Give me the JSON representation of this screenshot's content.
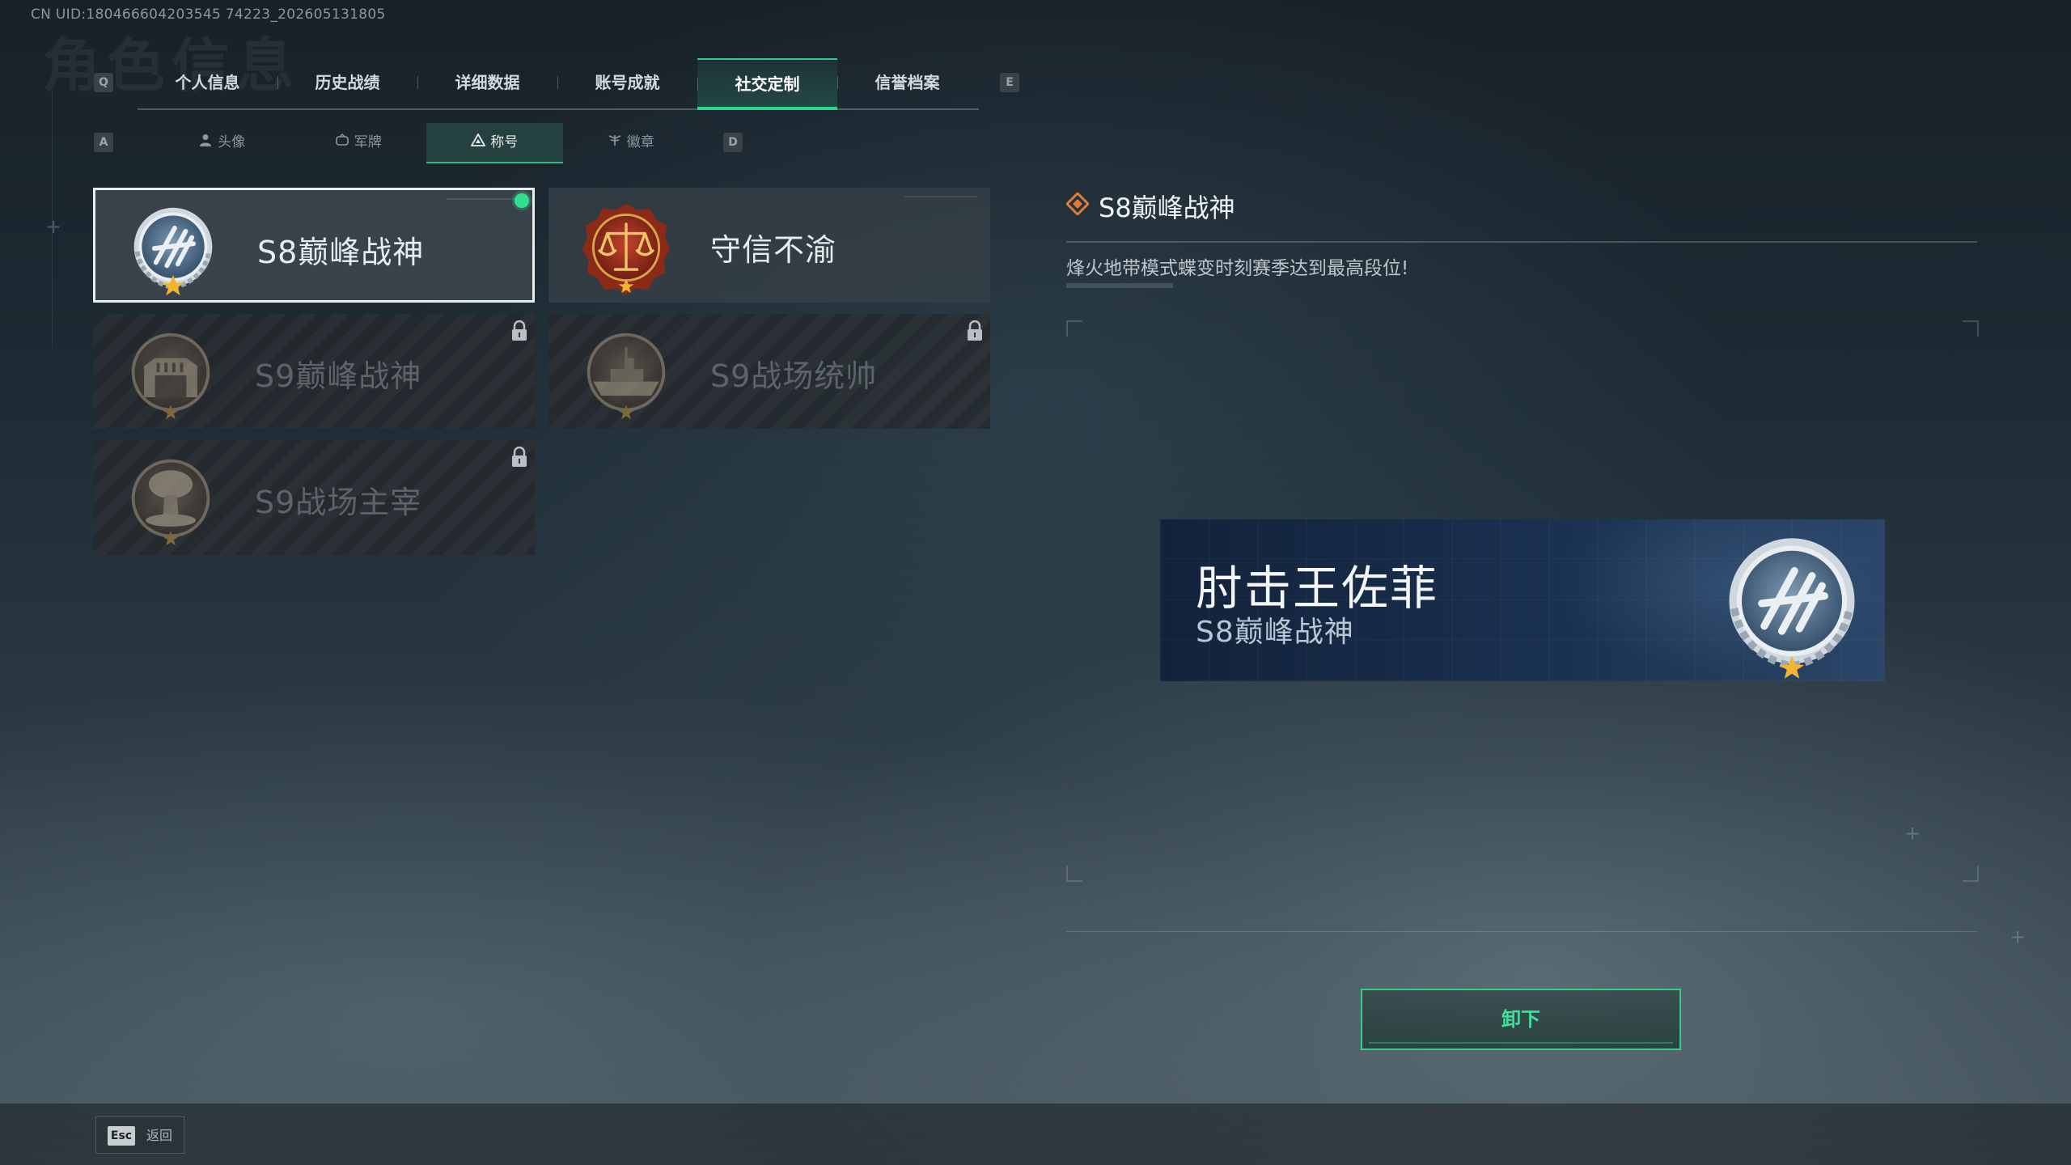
{
  "uid": "CN UID:180466604203545 74223_202605131805",
  "header": {
    "ghost_title": "角色信息",
    "prev_key": "Q",
    "next_key": "E",
    "tabs": [
      "个人信息",
      "历史战绩",
      "详细数据",
      "账号成就",
      "社交定制",
      "信誉档案"
    ],
    "active_tab": "社交定制"
  },
  "subnav": {
    "prev_key": "A",
    "next_key": "D",
    "tabs": [
      {
        "label": "头像",
        "icon": "person-icon"
      },
      {
        "label": "军牌",
        "icon": "dogtag-icon"
      },
      {
        "label": "称号",
        "icon": "title-triangle-icon"
      },
      {
        "label": "徽章",
        "icon": "wings-badge-icon"
      }
    ],
    "active_tab": "称号"
  },
  "titles": [
    {
      "name": "S8巅峰战神",
      "badge": "laurel-blue-badge",
      "state": "equipped"
    },
    {
      "name": "守信不渝",
      "badge": "scales-of-justice-badge",
      "state": "unlocked"
    },
    {
      "name": "S9巅峰战神",
      "badge": "fortress-badge",
      "state": "locked"
    },
    {
      "name": "S9战场统帅",
      "badge": "warship-badge",
      "state": "locked"
    },
    {
      "name": "S9战场主宰",
      "badge": "mushroom-cloud-badge",
      "state": "locked"
    }
  ],
  "detail": {
    "title": "S8巅峰战神",
    "description": "烽火地带模式蝶变时刻赛季达到最高段位!"
  },
  "preview": {
    "player_name": "肘击王佐菲",
    "title": "S8巅峰战神"
  },
  "actions": {
    "unequip_label": "卸下",
    "esc_key": "Esc",
    "back_label": "返回"
  },
  "colors": {
    "accent_green": "#2ed38c",
    "equipped_dot": "#2fe08f",
    "gold_star": "#f2b531"
  }
}
